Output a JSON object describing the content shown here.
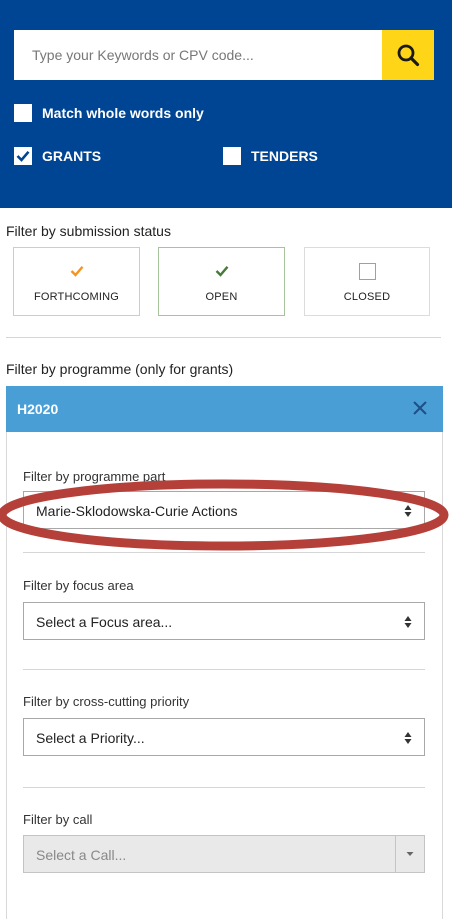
{
  "search": {
    "placeholder": "Type your Keywords or CPV code...",
    "value": "",
    "icon": "search-icon"
  },
  "options": {
    "match_whole_words": {
      "label": "Match whole words only",
      "checked": false
    },
    "grants": {
      "label": "GRANTS",
      "checked": true
    },
    "tenders": {
      "label": "TENDERS",
      "checked": false
    }
  },
  "submission_status": {
    "label": "Filter by submission status",
    "cards": [
      {
        "label": "FORTHCOMING",
        "checked": true,
        "color": "#f29527"
      },
      {
        "label": "OPEN",
        "checked": true,
        "color": "#467a39"
      },
      {
        "label": "CLOSED",
        "checked": false,
        "color": "#999999"
      }
    ]
  },
  "programme": {
    "label": "Filter by programme (only for grants)",
    "selected": "H2020",
    "header_color": "#4a9ed6"
  },
  "filters": {
    "programme_part": {
      "label": "Filter by programme part",
      "value": "Marie-Sklodowska-Curie Actions"
    },
    "focus_area": {
      "label": "Filter by focus area",
      "value": "Select a Focus area..."
    },
    "priority": {
      "label": "Filter by cross-cutting priority",
      "value": "Select a Priority..."
    },
    "call": {
      "label": "Filter by call",
      "value": "Select a Call...",
      "disabled": true
    }
  },
  "colors": {
    "top_bar": "#004494",
    "search_button": "#ffd617",
    "highlight": "#b5403a"
  }
}
